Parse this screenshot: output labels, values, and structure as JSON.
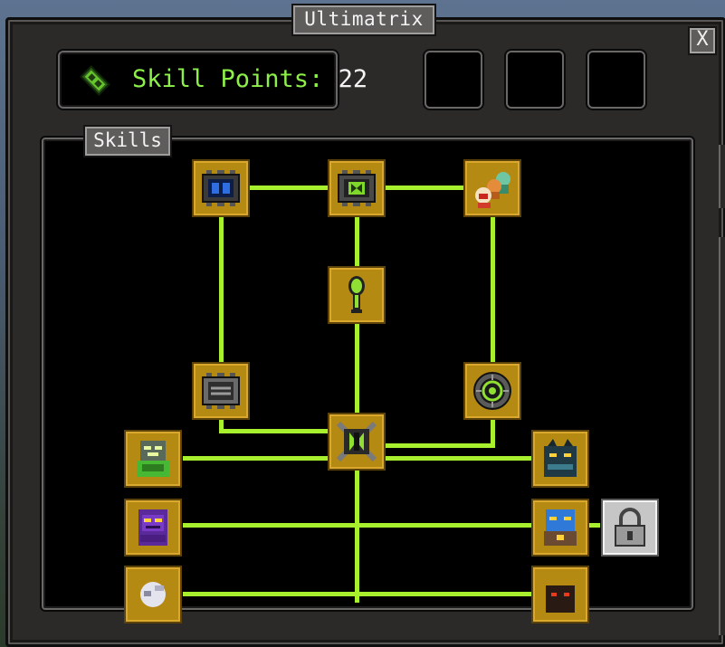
{
  "window": {
    "title": "Ultimatrix",
    "close_label": "X"
  },
  "skill_points": {
    "label": "Skill Points:",
    "value": "22"
  },
  "slots": [
    "empty",
    "empty",
    "empty"
  ],
  "panel": {
    "title": "Skills"
  },
  "colors": {
    "connector": "#a8f02e",
    "node_bg": "#b58a12",
    "points_text": "#8df04a",
    "locked_bg": "#c6c6c6"
  },
  "nodes": [
    {
      "id": "device-blue",
      "icon": "blue-screen-device-icon",
      "state": "unlocked"
    },
    {
      "id": "device-green",
      "icon": "green-screen-device-icon",
      "state": "unlocked"
    },
    {
      "id": "aliens-group",
      "icon": "alien-group-icon",
      "state": "unlocked"
    },
    {
      "id": "key",
      "icon": "omnitrix-key-icon",
      "state": "unlocked"
    },
    {
      "id": "device-grey",
      "icon": "grey-screen-device-icon",
      "state": "unlocked"
    },
    {
      "id": "dial",
      "icon": "omnitrix-dial-icon",
      "state": "unlocked"
    },
    {
      "id": "core",
      "icon": "omnitrix-core-icon",
      "state": "unlocked"
    },
    {
      "id": "alien-green",
      "icon": "green-alien-icon",
      "state": "unlocked"
    },
    {
      "id": "alien-purple",
      "icon": "purple-alien-icon",
      "state": "unlocked"
    },
    {
      "id": "alien-white",
      "icon": "white-alien-icon",
      "state": "unlocked"
    },
    {
      "id": "alien-teal",
      "icon": "teal-alien-icon",
      "state": "unlocked"
    },
    {
      "id": "alien-blue",
      "icon": "blue-alien-icon",
      "state": "unlocked"
    },
    {
      "id": "alien-dark",
      "icon": "dark-alien-icon",
      "state": "unlocked"
    },
    {
      "id": "locked",
      "icon": "padlock-icon",
      "state": "locked"
    }
  ]
}
